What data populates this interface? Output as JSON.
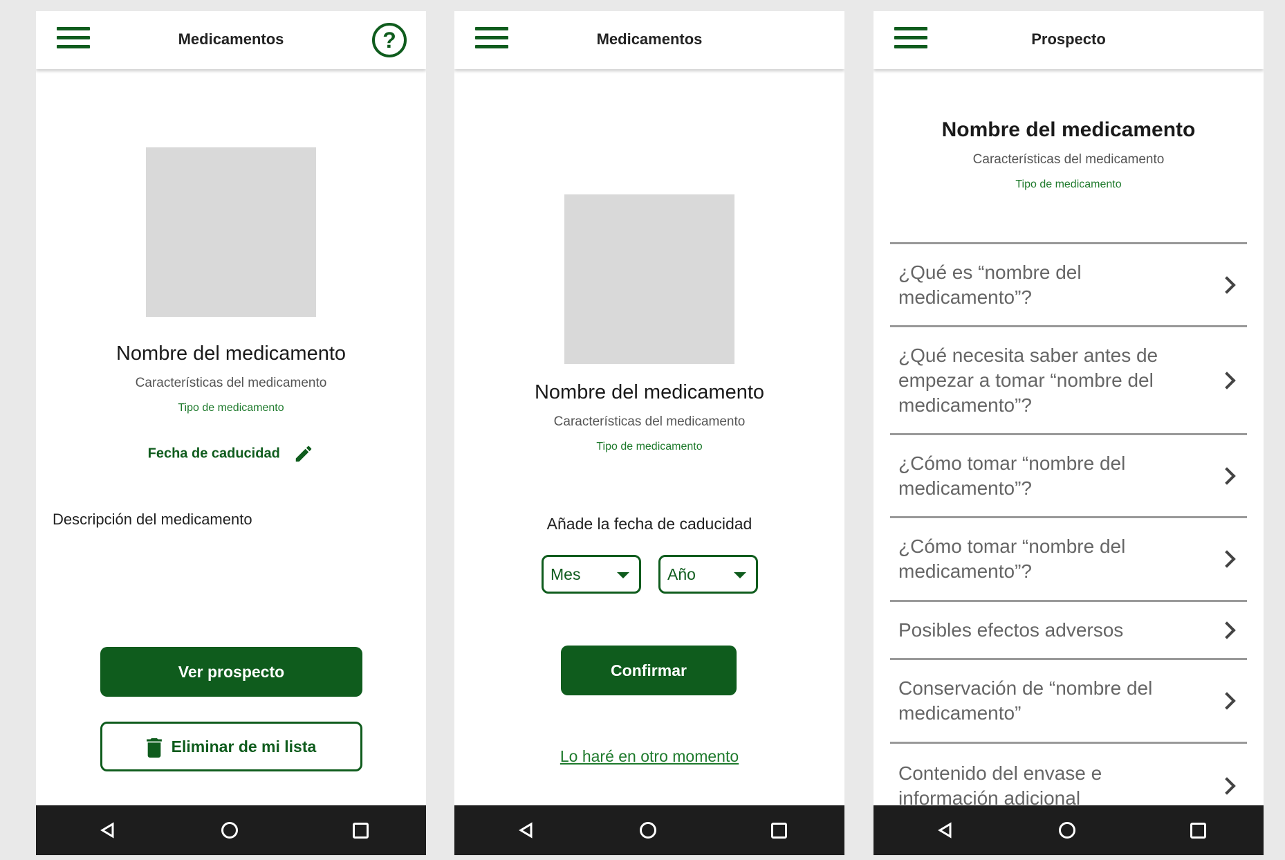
{
  "screens": [
    {
      "title": "Medicamentos",
      "med_name": "Nombre del medicamento",
      "med_characteristics": "Características del medicamento",
      "med_type": "Tipo de medicamento",
      "expiry_label": "Fecha de caducidad",
      "description": "Descripción del medicamento",
      "view_leaflet_button": "Ver prospecto",
      "remove_button": "Eliminar de mi lista",
      "icons": [
        "menu-icon",
        "help-icon",
        "pencil-icon",
        "trash-icon"
      ]
    },
    {
      "title": "Medicamentos",
      "med_name": "Nombre del medicamento",
      "med_characteristics": "Características del medicamento",
      "med_type": "Tipo de medicamento",
      "add_expiry_label": "Añade la fecha de caducidad",
      "month_select": "Mes",
      "year_select": "Año",
      "confirm_button": "Confirmar",
      "later_link": "Lo haré en otro momento"
    },
    {
      "title": "Prospecto",
      "med_name": "Nombre del medicamento",
      "med_characteristics": "Características del medicamento",
      "med_type": "Tipo de medicamento",
      "sections": [
        "¿Qué es “nombre del medicamento”?",
        "¿Qué necesita saber antes de empezar a tomar “nombre del medicamento”?",
        "¿Cómo tomar “nombre del medicamento”?",
        "¿Cómo tomar “nombre del medicamento”?",
        "Posibles efectos adversos",
        "Conservación de “nombre del medicamento”",
        "Contenido del envase e información adicional"
      ]
    }
  ],
  "colors": {
    "primary": "#0f5c1d",
    "accent_text": "#1e7a2c",
    "placeholder": "#d9d9d9",
    "divider": "#999999",
    "navbar": "#1d1d1d",
    "background": "#e9e9e9"
  }
}
